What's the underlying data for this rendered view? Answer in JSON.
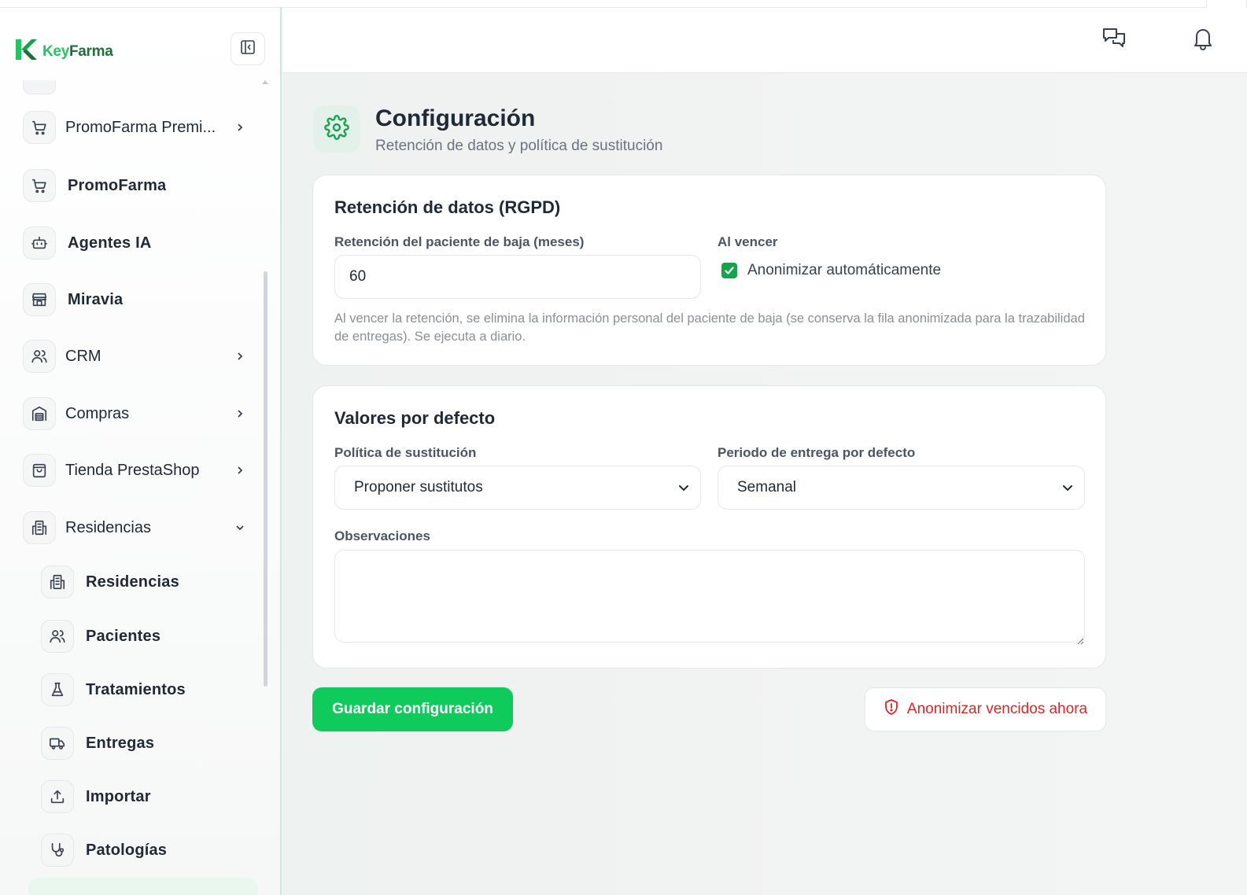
{
  "brand": {
    "name_part1": "Key",
    "name_part2": "Farma"
  },
  "sidebar": {
    "items": [
      {
        "label": "PromoFarma Premi...",
        "icon": "cart-icon",
        "chevron": "right"
      },
      {
        "label": "PromoFarma",
        "icon": "cart-icon"
      },
      {
        "label": "Agentes IA",
        "icon": "robot-icon"
      },
      {
        "label": "Miravia",
        "icon": "store-icon"
      },
      {
        "label": "CRM",
        "icon": "users-icon",
        "chevron": "right"
      },
      {
        "label": "Compras",
        "icon": "warehouse-icon",
        "chevron": "right"
      },
      {
        "label": "Tienda PrestaShop",
        "icon": "shopping-bag-icon",
        "chevron": "right"
      },
      {
        "label": "Residencias",
        "icon": "building-icon",
        "chevron": "down"
      }
    ],
    "subitems": [
      {
        "label": "Residencias",
        "icon": "building-icon"
      },
      {
        "label": "Pacientes",
        "icon": "users-icon"
      },
      {
        "label": "Tratamientos",
        "icon": "flask-icon"
      },
      {
        "label": "Entregas",
        "icon": "truck-icon"
      },
      {
        "label": "Importar",
        "icon": "upload-icon"
      },
      {
        "label": "Patologías",
        "icon": "stethoscope-icon"
      }
    ]
  },
  "page": {
    "title": "Configuración",
    "subtitle": "Retención de datos y política de sustitución"
  },
  "retention": {
    "title": "Retención de datos (RGPD)",
    "months_label": "Retención del paciente de baja (meses)",
    "months_value": "60",
    "expire_label": "Al vencer",
    "auto_anonymize_label": "Anonimizar automáticamente",
    "auto_anonymize_checked": true,
    "help": "Al vencer la retención, se elimina la información personal del paciente de baja (se conserva la fila anonimizada para la trazabilidad de entregas). Se ejecuta a diario."
  },
  "defaults": {
    "title": "Valores por defecto",
    "policy_label": "Política de sustitución",
    "policy_value": "Proponer sustitutos",
    "period_label": "Periodo de entrega por defecto",
    "period_value": "Semanal",
    "notes_label": "Observaciones",
    "notes_value": ""
  },
  "actions": {
    "save_label": "Guardar configuración",
    "anonymize_label": "Anonimizar vencidos ahora"
  },
  "colors": {
    "accent": "#0fcb5c",
    "accent_dark": "#16a34a",
    "danger": "#dc2626"
  }
}
